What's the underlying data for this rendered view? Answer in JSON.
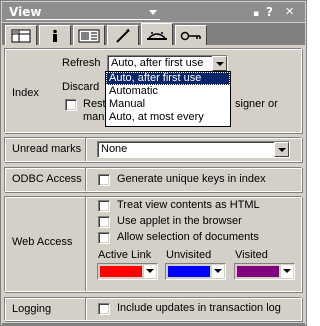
{
  "window": {
    "title": "View"
  },
  "titlebar": {
    "collapse_glyph": "▪",
    "help_glyph": "?",
    "close_glyph": "✕"
  },
  "tabs": [
    {
      "icon": "grid-properties-icon"
    },
    {
      "icon": "info-icon"
    },
    {
      "icon": "column-format-icon"
    },
    {
      "icon": "brush-icon"
    },
    {
      "icon": "hat-icon",
      "active": true
    },
    {
      "icon": "key-icon"
    }
  ],
  "index": {
    "label": "Index",
    "refresh_label": "Refresh",
    "refresh_value": "Auto, after first use",
    "discard_label": "Discard",
    "restrict_partial": "Rest",
    "restrict_partial2": "man",
    "restrict_tail": "signer or",
    "options": [
      "Auto, after first use",
      "Automatic",
      "Manual",
      "Auto, at most every"
    ],
    "selected_option": "Auto, after first use"
  },
  "unread": {
    "label": "Unread marks",
    "value": "None"
  },
  "odbc": {
    "label": "ODBC Access",
    "checkbox": "Generate unique keys in index"
  },
  "web": {
    "label": "Web Access",
    "checkboxes": [
      "Treat view contents as HTML",
      "Use applet in the browser",
      "Allow selection of documents"
    ],
    "colors": [
      {
        "label": "Active Link",
        "color": "#ff0000"
      },
      {
        "label": "Unvisited",
        "color": "#0000ff"
      },
      {
        "label": "Visited",
        "color": "#800080"
      }
    ]
  },
  "logging": {
    "label": "Logging",
    "checkbox": "Include updates in transaction log"
  }
}
